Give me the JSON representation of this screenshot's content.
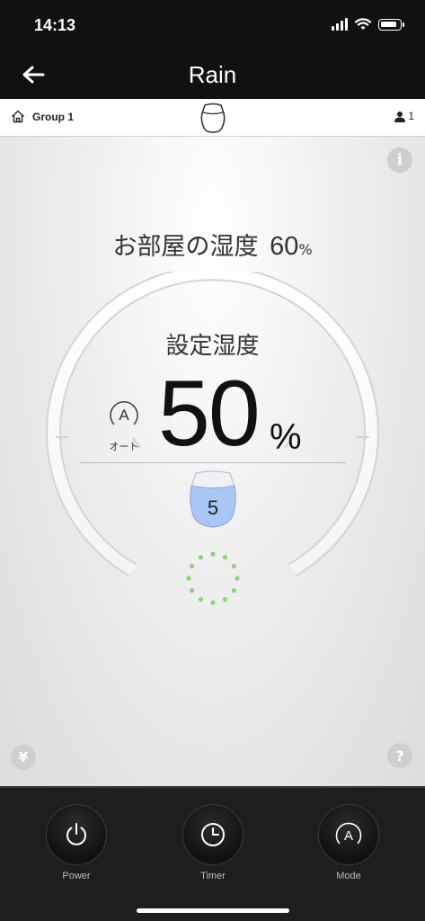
{
  "status_bar": {
    "time": "14:13"
  },
  "nav": {
    "title": "Rain"
  },
  "group_bar": {
    "group_name": "Group 1",
    "user_count": "1"
  },
  "main": {
    "room_label": "お部屋の湿度",
    "room_value": "60",
    "room_unit": "%",
    "set_label": "設定湿度",
    "mode_symbol": "A",
    "mode_label": "オート",
    "set_value": "50",
    "set_unit": "%",
    "tank_level": "5",
    "info_symbol": "i",
    "help_symbol": "?",
    "yen_symbol": "¥"
  },
  "controls": [
    {
      "label": "Power"
    },
    {
      "label": "Timer"
    },
    {
      "label": "Mode"
    }
  ],
  "colors": {
    "tank_blue": "#a9c6f5",
    "indicator_green": "#8bd27a"
  },
  "icons": [
    "back-arrow-icon",
    "home-icon",
    "humidifier-icon",
    "user-icon",
    "info-icon",
    "yen-icon",
    "help-icon",
    "auto-mode-icon",
    "water-tank-icon",
    "loading-dots-icon",
    "power-icon",
    "clock-icon",
    "mode-icon"
  ]
}
